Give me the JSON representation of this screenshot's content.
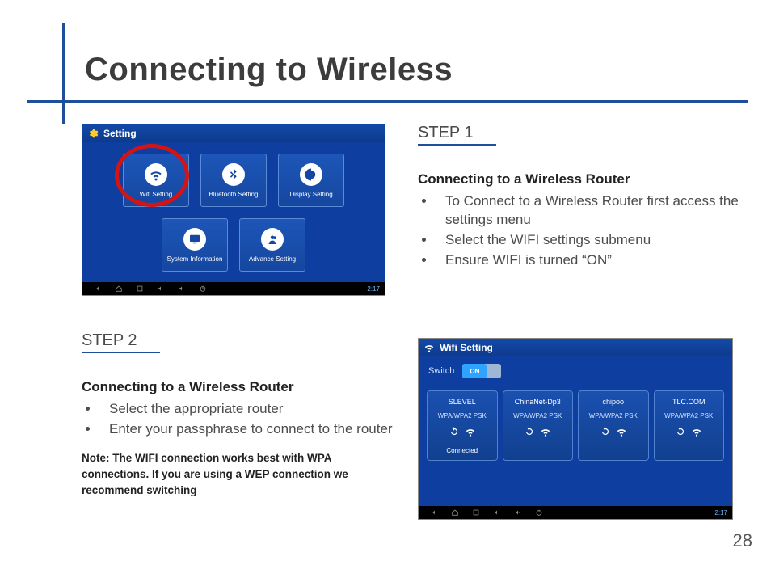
{
  "title": "Connecting to Wireless",
  "page_number": "28",
  "step1": {
    "label": "STEP 1",
    "subtitle": "Connecting to a Wireless Router",
    "bullets": [
      "To Connect to a Wireless Router first access the settings menu",
      "Select the WIFI settings submenu",
      "Ensure WIFI is turned “ON”"
    ]
  },
  "step2": {
    "label": "STEP 2",
    "subtitle": "Connecting to a Wireless Router",
    "bullets": [
      "Select the appropriate router",
      "Enter your passphrase to connect to the router"
    ],
    "note": "Note: The WIFI connection works best with WPA connections.  If you are using a WEP connection we recommend switching"
  },
  "ss_settings": {
    "header": "Setting",
    "tiles": [
      {
        "label": "Wifi Setting",
        "icon": "wifi"
      },
      {
        "label": "Bluetooth Setting",
        "icon": "bluetooth"
      },
      {
        "label": "Display Setting",
        "icon": "display"
      },
      {
        "label": "System Information",
        "icon": "system"
      },
      {
        "label": "Advance Setting",
        "icon": "advance"
      }
    ],
    "navbar_time": "2:17"
  },
  "ss_wifi": {
    "header": "Wifi Setting",
    "switch_label": "Switch",
    "switch_state": "ON",
    "networks": [
      {
        "ssid": "SLEVEL",
        "security": "WPA/WPA2 PSK",
        "status": "Connected"
      },
      {
        "ssid": "ChinaNet-Dp3",
        "security": "WPA/WPA2 PSK",
        "status": ""
      },
      {
        "ssid": "chipoo",
        "security": "WPA/WPA2 PSK",
        "status": ""
      },
      {
        "ssid": "TLC.COM",
        "security": "WPA/WPA2 PSK",
        "status": ""
      }
    ],
    "navbar_time": "2:17"
  }
}
